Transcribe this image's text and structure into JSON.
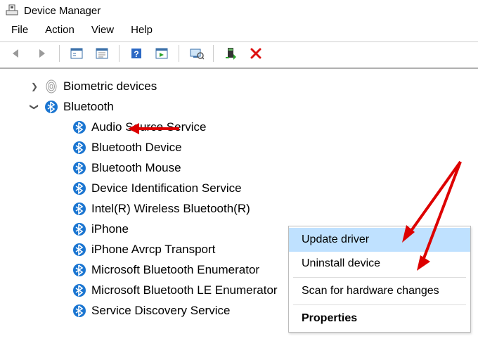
{
  "window": {
    "title": "Device Manager"
  },
  "menu": {
    "file": "File",
    "action": "Action",
    "view": "View",
    "help": "Help"
  },
  "tree": {
    "biometric": "Biometric devices",
    "bluetooth": "Bluetooth",
    "children": [
      "Audio Source Service",
      "Bluetooth Device",
      "Bluetooth Mouse",
      "Device Identification Service",
      "Intel(R) Wireless Bluetooth(R)",
      "iPhone",
      "iPhone Avrcp Transport",
      "Microsoft Bluetooth Enumerator",
      "Microsoft Bluetooth LE Enumerator",
      "Service Discovery Service"
    ]
  },
  "context_menu": {
    "update": "Update driver",
    "uninstall": "Uninstall device",
    "scan": "Scan for hardware changes",
    "properties": "Properties"
  }
}
